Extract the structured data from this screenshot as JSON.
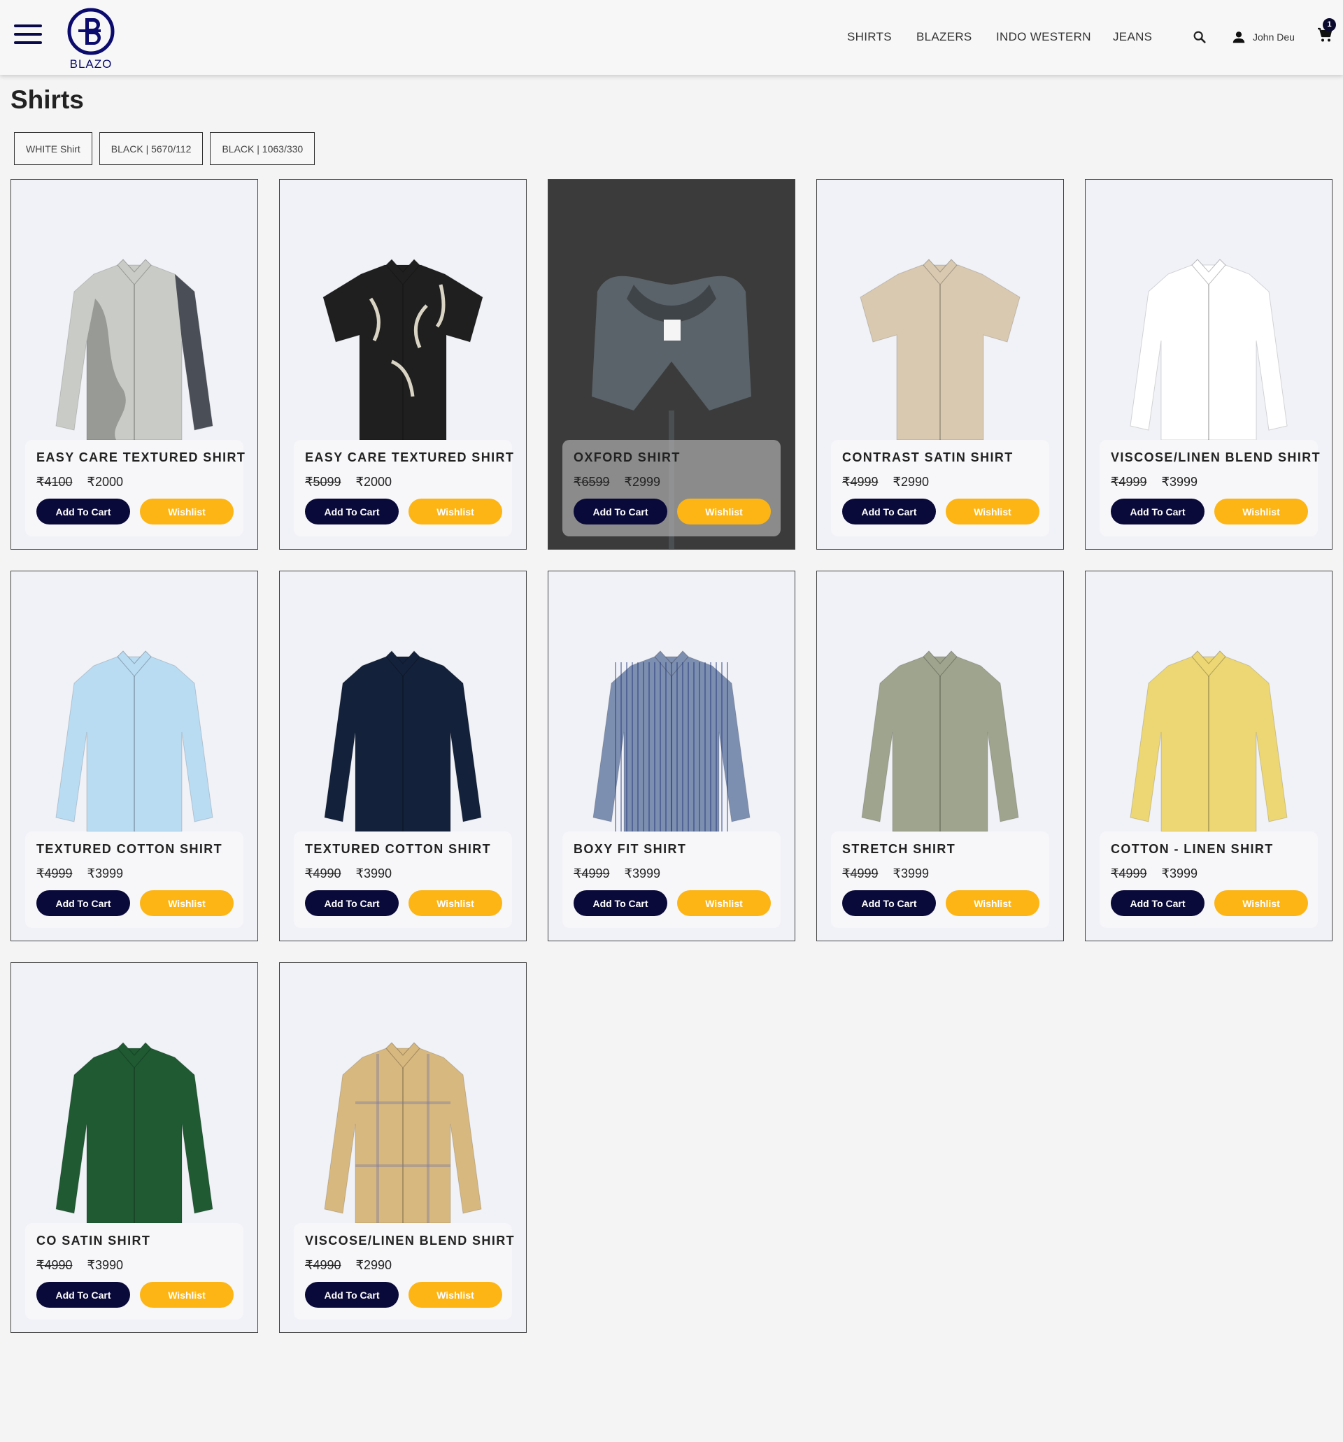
{
  "brand": {
    "name": "BLAZO",
    "color": "#0b0b6e"
  },
  "nav": {
    "links": [
      "SHIRTS",
      "BLAZERS",
      "INDO WESTERN",
      "JEANS"
    ],
    "user_name": "John Deu",
    "cart_count": "1",
    "icons": [
      "menu-icon",
      "search-icon",
      "user-icon",
      "cart-icon"
    ]
  },
  "page": {
    "title": "Shirts"
  },
  "filters": [
    "WHITE Shirt",
    "BLACK | 5670/112",
    "BLACK | 1063/330"
  ],
  "colors": {
    "accent_dark": "#0a0a3a",
    "accent_yellow": "#fcb514"
  },
  "products": [
    {
      "name": "EASY CARE TEXTURED SHIRT",
      "old_price": "₹4100",
      "price": "₹2000",
      "cart_label": "Add To Cart",
      "wishlist_label": "Wishlist",
      "shirt_color": "#c9ccc6"
    },
    {
      "name": "EASY CARE TEXTURED SHIRT",
      "old_price": "₹5099",
      "price": "₹2000",
      "cart_label": "Add To Cart",
      "wishlist_label": "Wishlist",
      "shirt_color": "#1f1f1f"
    },
    {
      "name": "OXFORD SHIRT",
      "old_price": "₹6599",
      "price": "₹2999",
      "cart_label": "Add To Cart",
      "wishlist_label": "Wishlist",
      "shirt_color": "#3a3a3a"
    },
    {
      "name": "CONTRAST SATIN SHIRT",
      "old_price": "₹4999",
      "price": "₹2990",
      "cart_label": "Add To Cart",
      "wishlist_label": "Wishlist",
      "shirt_color": "#d8c9b0"
    },
    {
      "name": "VISCOSE/LINEN BLEND SHIRT",
      "old_price": "₹4999",
      "price": "₹3999",
      "cart_label": "Add To Cart",
      "wishlist_label": "Wishlist",
      "shirt_color": "#ffffff"
    },
    {
      "name": "TEXTURED COTTON SHIRT",
      "old_price": "₹4999",
      "price": "₹3999",
      "cart_label": "Add To Cart",
      "wishlist_label": "Wishlist",
      "shirt_color": "#b9dcf3"
    },
    {
      "name": "TEXTURED COTTON SHIRT",
      "old_price": "₹4990",
      "price": "₹3990",
      "cart_label": "Add To Cart",
      "wishlist_label": "Wishlist",
      "shirt_color": "#13213a"
    },
    {
      "name": "BOXY FIT SHIRT",
      "old_price": "₹4999",
      "price": "₹3999",
      "cart_label": "Add To Cart",
      "wishlist_label": "Wishlist",
      "shirt_color": "#7d8fb0"
    },
    {
      "name": "STRETCH SHIRT",
      "old_price": "₹4999",
      "price": "₹3999",
      "cart_label": "Add To Cart",
      "wishlist_label": "Wishlist",
      "shirt_color": "#9ea48d"
    },
    {
      "name": "COTTON - LINEN SHIRT",
      "old_price": "₹4999",
      "price": "₹3999",
      "cart_label": "Add To Cart",
      "wishlist_label": "Wishlist",
      "shirt_color": "#ecd774"
    },
    {
      "name": "CO SATIN SHIRT",
      "old_price": "₹4990",
      "price": "₹3990",
      "cart_label": "Add To Cart",
      "wishlist_label": "Wishlist",
      "shirt_color": "#1f5a32"
    },
    {
      "name": "VISCOSE/LINEN BLEND SHIRT",
      "old_price": "₹4990",
      "price": "₹2990",
      "cart_label": "Add To Cart",
      "wishlist_label": "Wishlist",
      "shirt_color": "#d7b87f"
    }
  ]
}
